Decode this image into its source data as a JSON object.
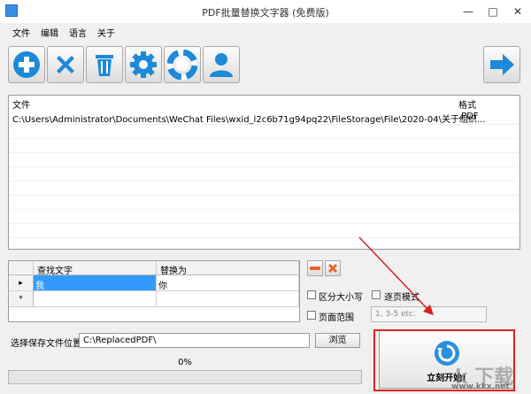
{
  "window": {
    "title": "PDF批量替换文字器 (免费版)",
    "minimize": "—",
    "maximize": "□",
    "close": "✕"
  },
  "menu": [
    "文件",
    "编辑",
    "语言",
    "关于"
  ],
  "toolbar": {
    "icons": [
      "add-icon",
      "delete-icon",
      "trash-icon",
      "settings-icon",
      "help-icon",
      "user-icon",
      "arrow-right-icon"
    ],
    "colors": {
      "blue": "#1c8ad8",
      "white": "#ffffff"
    }
  },
  "file_list": {
    "headers": {
      "file": "文件",
      "format": "格式"
    },
    "rows": [
      {
        "file": "C:\\Users\\Administrator\\Documents\\WeChat Files\\wxid_l2c6b71g94pq22\\FileStorage\\File\\2020-04\\关于组织...",
        "format": ".PDF"
      }
    ]
  },
  "replace_grid": {
    "headers": {
      "find": "查找文字",
      "replace": "替换为"
    },
    "rows": [
      {
        "marker": "▸",
        "find": "我",
        "replace": "你"
      },
      {
        "marker": "*",
        "find": "",
        "replace": ""
      }
    ]
  },
  "options": {
    "case_sensitive": "区分大小写",
    "page_mode": "逐页模式",
    "page_range": "页面范围",
    "range_placeholder": "1, 3-5 etc."
  },
  "save": {
    "label": "选择保存文件位置",
    "path": "C:\\ReplacedPDF\\",
    "browse": "浏览"
  },
  "progress": {
    "percent_text": "0%",
    "value": 0.0
  },
  "start": {
    "label": "立刻开始!"
  },
  "watermark": {
    "text": "k 下载",
    "url": "www.kkx.net"
  }
}
